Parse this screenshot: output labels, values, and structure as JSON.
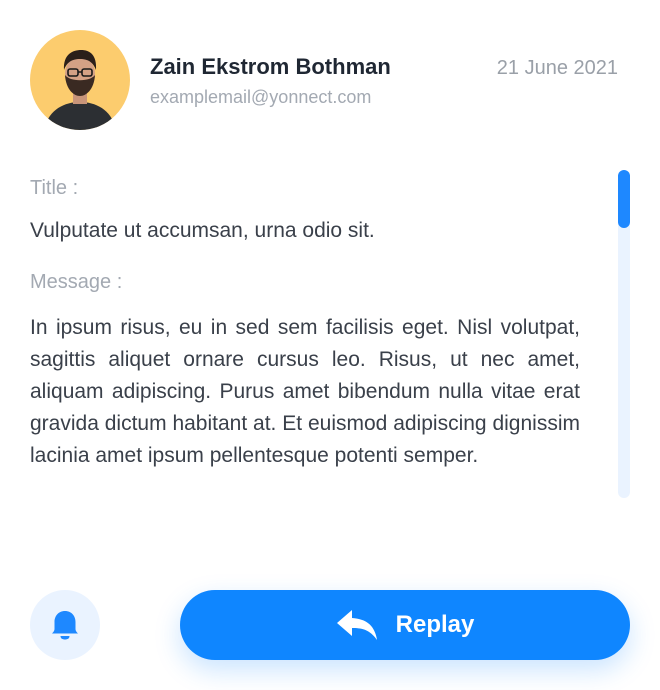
{
  "sender": {
    "name": "Zain Ekstrom Bothman",
    "email": "examplemail@yonnect.com",
    "avatar_bg": "#fccc6e"
  },
  "date": "21 June 2021",
  "mail": {
    "title_label": "Title :",
    "title": "Vulputate ut accumsan, urna odio sit.",
    "message_label": "Message :",
    "message": "In ipsum risus, eu in sed sem facilisis eget. Nisl volutpat, sagittis aliquet ornare cursus leo. Risus, ut nec amet, aliquam adipiscing. Purus amet bibendum nulla vitae erat gravida dictum habitant at. Et euismod adipiscing dignissim lacinia amet ipsum pellentesque potenti semper."
  },
  "actions": {
    "bell_icon": "bell-icon",
    "reply_icon": "reply-arrow-icon",
    "reply_label": "Replay"
  },
  "colors": {
    "accent": "#0f86ff",
    "accent_light": "#eaf3ff",
    "muted_text": "#a3a9b2"
  }
}
